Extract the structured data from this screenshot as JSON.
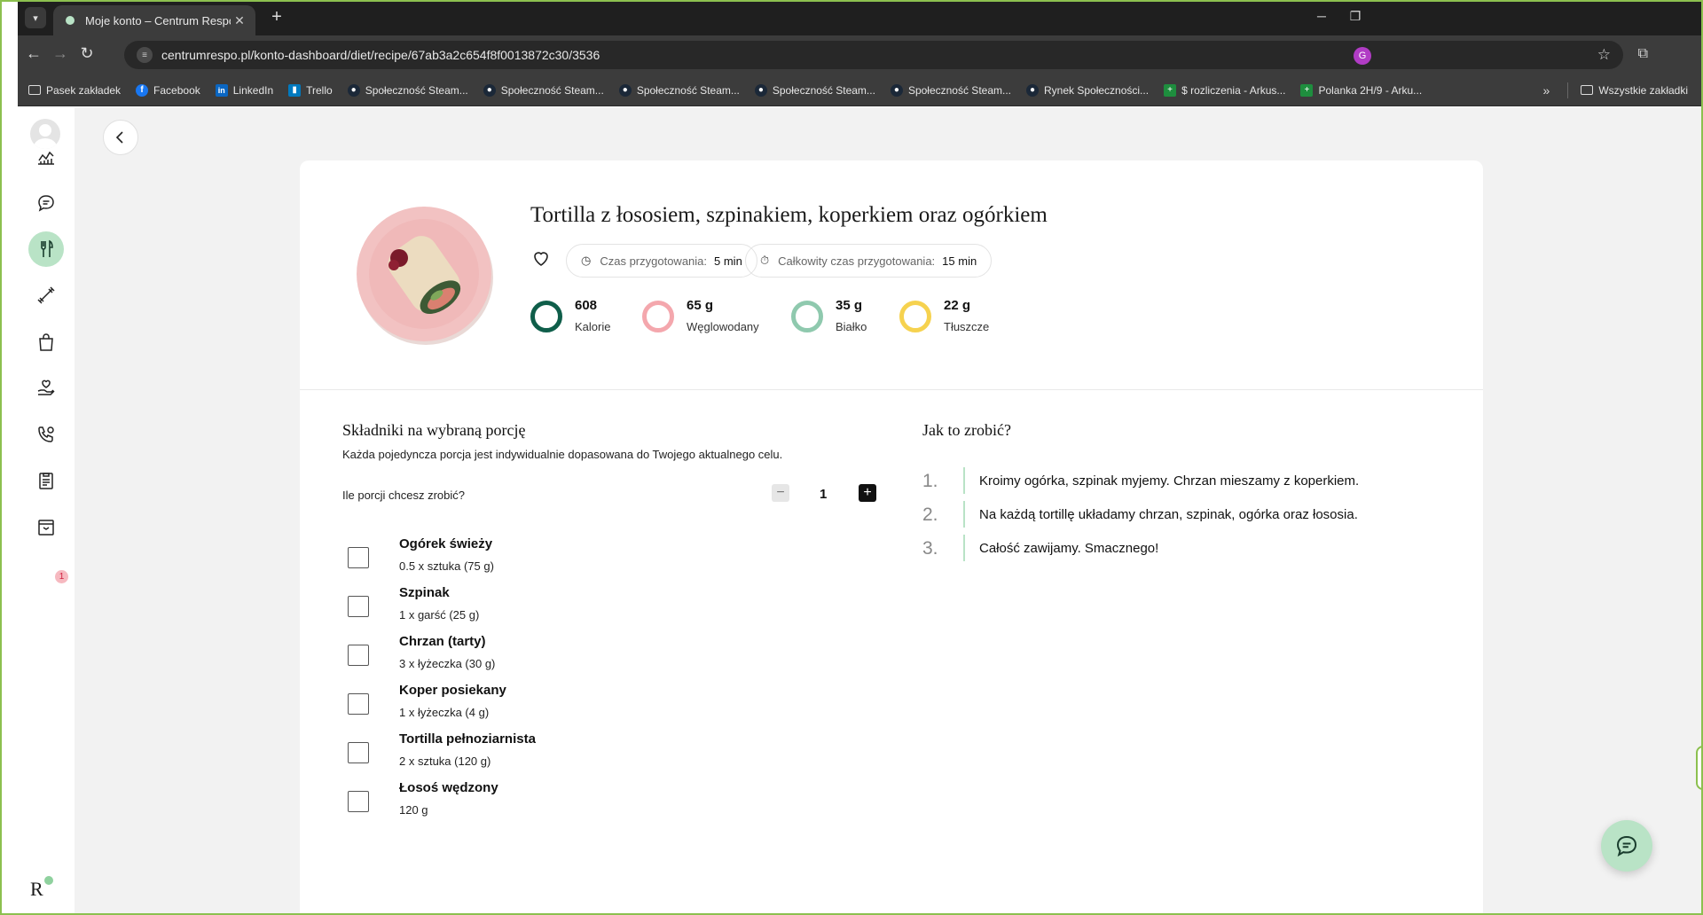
{
  "browser": {
    "tab_title": "Moje konto – Centrum Respo",
    "url": "centrumrespo.pl/konto-dashboard/diet/recipe/67ab3a2c654f8f0013872c30/3536",
    "profile_initial": "G",
    "bookmarks": [
      {
        "label": "Pasek zakładek",
        "icon": "folder-icon"
      },
      {
        "label": "Facebook",
        "icon": "facebook-icon"
      },
      {
        "label": "LinkedIn",
        "icon": "linkedin-icon"
      },
      {
        "label": "Trello",
        "icon": "trello-icon"
      },
      {
        "label": "Społeczność Steam...",
        "icon": "steam-icon"
      },
      {
        "label": "Społeczność Steam...",
        "icon": "steam-icon"
      },
      {
        "label": "Społeczność Steam...",
        "icon": "steam-icon"
      },
      {
        "label": "Społeczność Steam...",
        "icon": "steam-icon"
      },
      {
        "label": "Społeczność Steam...",
        "icon": "steam-icon"
      },
      {
        "label": "Rynek Społeczności...",
        "icon": "steam-icon"
      },
      {
        "label": "$ rozliczenia - Arkus...",
        "icon": "sheets-icon"
      },
      {
        "label": "Polanka 2H/9 - Arku...",
        "icon": "sheets-icon"
      }
    ],
    "all_bookmarks": "Wszystkie zakładki"
  },
  "sidebar": {
    "items": [
      "avatar",
      "chart-icon",
      "chat-icon",
      "fork-knife-icon",
      "dumbbell-icon",
      "shopping-bag-icon",
      "hand-heart-icon",
      "phone-heart-icon",
      "clipboard-icon",
      "archive-box-icon"
    ],
    "active": "fork-knife-icon",
    "badge_count": "1",
    "logo": "R"
  },
  "recipe": {
    "title": "Tortilla z łososiem, szpinakiem, koperkiem oraz ogórkiem",
    "prep_label": "Czas przygotowania:",
    "prep_value": "5 min",
    "total_label": "Całkowity czas przygotowania:",
    "total_value": "15 min",
    "macros": [
      {
        "value": "608",
        "label": "Kalorie",
        "color": "#0f5e4a"
      },
      {
        "value": "65 g",
        "label": "Węglowodany",
        "color": "#f4a7ad"
      },
      {
        "value": "35 g",
        "label": "Białko",
        "color": "#8fc9ae"
      },
      {
        "value": "22 g",
        "label": "Tłuszcze",
        "color": "#f6d24f"
      }
    ]
  },
  "ingredients": {
    "heading": "Składniki na wybraną porcję",
    "subtitle": "Każda pojedyncza porcja jest indywidualnie dopasowana do Twojego aktualnego celu.",
    "portions_question": "Ile porcji chcesz zrobić?",
    "portions": "1",
    "items": [
      {
        "name": "Ogórek świeży",
        "qty": "0.5 x sztuka (75 g)"
      },
      {
        "name": "Szpinak",
        "qty": "1 x garść (25 g)"
      },
      {
        "name": "Chrzan (tarty)",
        "qty": "3 x łyżeczka (30 g)"
      },
      {
        "name": "Koper posiekany",
        "qty": "1 x łyżeczka (4 g)"
      },
      {
        "name": "Tortilla pełnoziarnista",
        "qty": "2 x sztuka (120 g)"
      },
      {
        "name": "Łosoś wędzony",
        "qty": "120 g"
      }
    ]
  },
  "steps": {
    "heading": "Jak to zrobić?",
    "items": [
      {
        "num": "1.",
        "text": "Kroimy ogórka, szpinak myjemy. Chrzan mieszamy z koperkiem."
      },
      {
        "num": "2.",
        "text": "Na każdą tortillę układamy chrzan, szpinak, ogórka oraz łososia."
      },
      {
        "num": "3.",
        "text": "Całość zawijamy. Smacznego!"
      }
    ]
  },
  "colors": {
    "accent": "#b9e3c6",
    "frame": "#8cc04f"
  }
}
